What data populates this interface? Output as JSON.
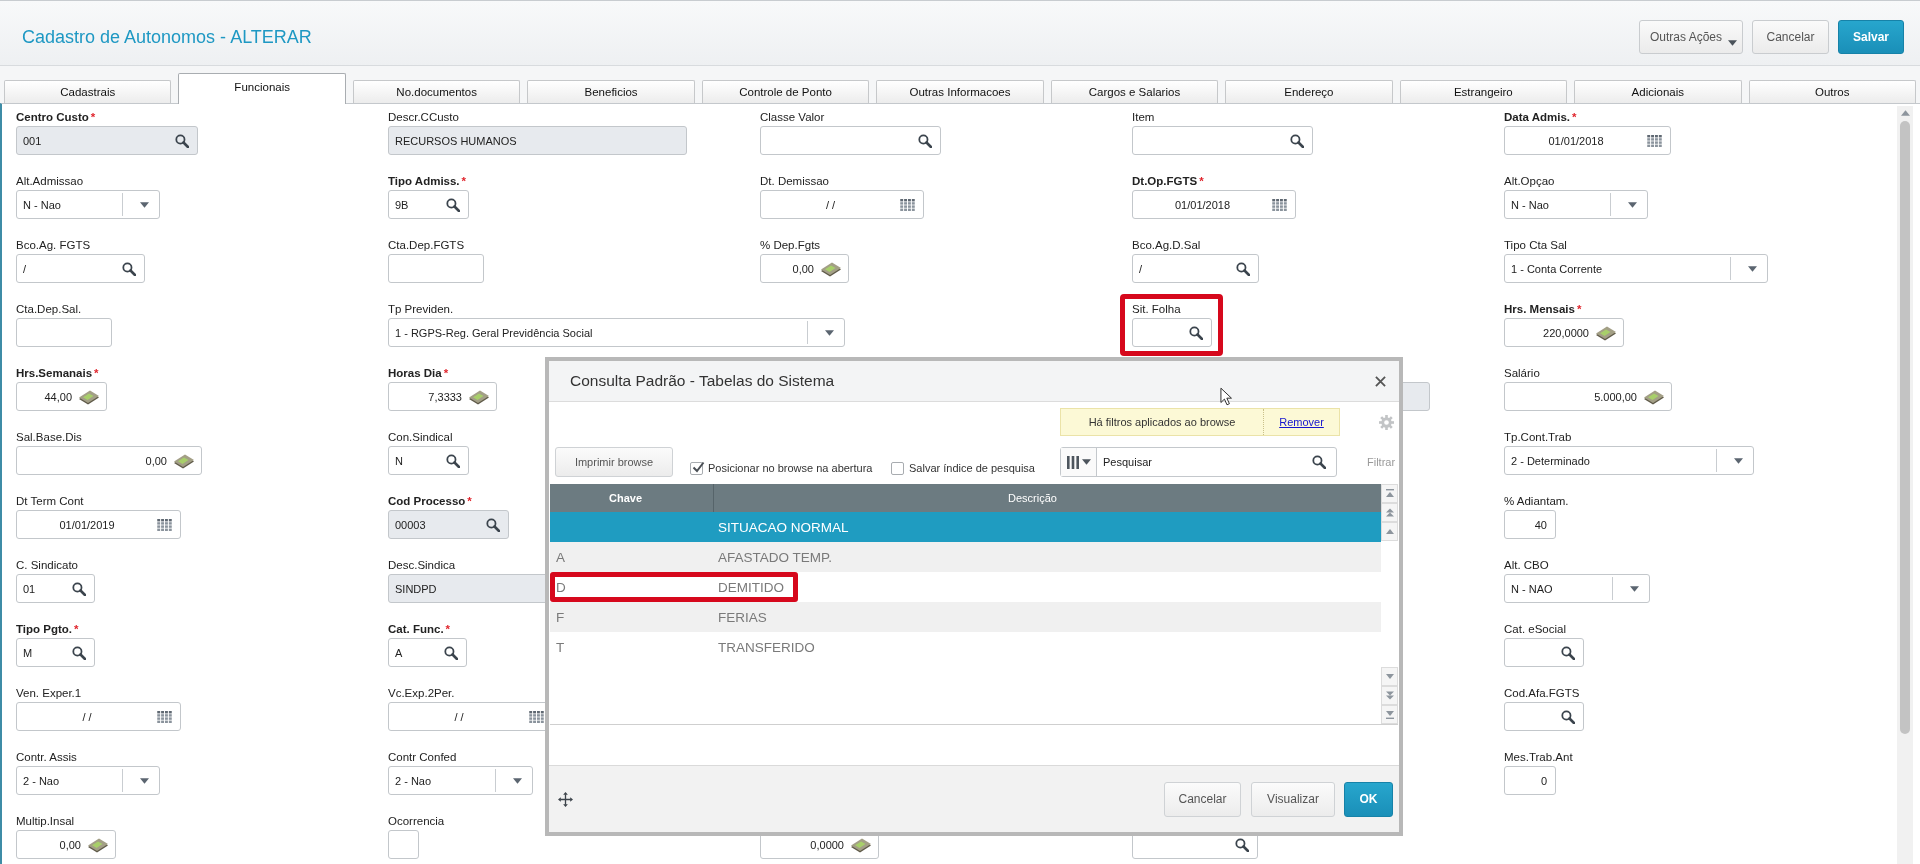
{
  "header": {
    "title": "Cadastro de Autonomos - ALTERAR",
    "actions": [
      {
        "label": "Outras Ações",
        "kind": "menu"
      },
      {
        "label": "Cancelar",
        "kind": "cancel"
      },
      {
        "label": "Salvar",
        "kind": "confirm"
      }
    ]
  },
  "tabs": [
    {
      "label": "Cadastrais",
      "selected": false
    },
    {
      "label": "Funcionais",
      "selected": true
    },
    {
      "label": "No.documentos",
      "selected": false
    },
    {
      "label": "Beneficios",
      "selected": false
    },
    {
      "label": "Controle de Ponto",
      "selected": false
    },
    {
      "label": "Outras Informacoes",
      "selected": false
    },
    {
      "label": "Cargos e Salarios",
      "selected": false
    },
    {
      "label": "Endereço",
      "selected": false
    },
    {
      "label": "Estrangeiro",
      "selected": false
    },
    {
      "label": "Adicionais",
      "selected": false
    },
    {
      "label": "Outros",
      "selected": false
    }
  ],
  "form": {
    "rows": [
      {
        "fields": [
          {
            "label": "Centro Custo",
            "required_mark": "*",
            "kind": "lookup",
            "value": "001",
            "readonly": true,
            "highlighted": false
          },
          {
            "label": "Descr.CCusto",
            "kind": "text",
            "value": "RECURSOS HUMANOS",
            "readonly": true,
            "highlighted": false
          },
          {
            "label": "Classe Valor",
            "kind": "lookup",
            "readonly": false,
            "highlighted": false
          },
          {
            "label": "Item",
            "kind": "lookup",
            "readonly": false,
            "highlighted": false
          },
          {
            "label": "Data Admis.",
            "required_mark": "*",
            "kind": "date",
            "value": "01/01/2018",
            "readonly": false,
            "highlighted": false
          }
        ]
      },
      {
        "fields": [
          {
            "label": "Alt.Admissao",
            "kind": "select",
            "value": "N - Nao",
            "readonly": false,
            "highlighted": false
          },
          {
            "label": "Tipo Admiss.",
            "required_mark": "*",
            "kind": "lookup",
            "value": "9B",
            "readonly": false,
            "highlighted": false
          },
          {
            "label": "Dt. Demissao",
            "kind": "date",
            "value": "/ /",
            "readonly": false,
            "highlighted": false
          },
          {
            "label": "Dt.Op.FGTS",
            "required_mark": "*",
            "kind": "date",
            "value": "01/01/2018",
            "readonly": false,
            "highlighted": false
          },
          {
            "label": "Alt.Opçao",
            "kind": "select",
            "value": "N - Nao",
            "readonly": false,
            "highlighted": false
          }
        ]
      },
      {
        "fields": [
          {
            "label": "Bco.Ag. FGTS",
            "kind": "lookup",
            "value": "/",
            "readonly": false,
            "highlighted": false
          },
          {
            "label": "Cta.Dep.FGTS",
            "kind": "text",
            "readonly": false,
            "highlighted": false
          },
          {
            "label": "% Dep.Fgts",
            "kind": "money",
            "value": "0,00",
            "readonly": false,
            "highlighted": false
          },
          {
            "label": "Bco.Ag.D.Sal",
            "kind": "lookup",
            "value": "/",
            "readonly": false,
            "highlighted": false
          },
          {
            "label": "Tipo Cta Sal",
            "kind": "select",
            "value": "1 - Conta Corrente",
            "readonly": false,
            "highlighted": false
          }
        ]
      },
      {
        "fields": [
          {
            "label": "Cta.Dep.Sal.",
            "kind": "text",
            "readonly": false,
            "highlighted": false
          },
          {
            "label": "Tp Previden.",
            "kind": "select",
            "value": "1 - RGPS-Reg. Geral Previdência Social",
            "readonly": false,
            "highlighted": false
          },
          {
            "label": "Sit. Folha",
            "kind": "lookup",
            "readonly": false,
            "highlighted": true
          },
          {
            "label": "Hrs. Mensais",
            "required_mark": "*",
            "kind": "money",
            "value": "220,0000",
            "readonly": false,
            "highlighted": false
          }
        ]
      },
      {
        "fields": [
          {
            "label": "Hrs.Semanais",
            "required_mark": "*",
            "kind": "money",
            "value": "44,00",
            "readonly": false,
            "highlighted": false
          },
          {
            "label": "Horas Dia",
            "required_mark": "*",
            "kind": "money",
            "value": "7,3333",
            "readonly": false,
            "highlighted": false
          },
          {
            "kind": "text",
            "readonly": true,
            "highlighted": false
          },
          {
            "label": "Salário",
            "kind": "money",
            "value": "5.000,00",
            "readonly": false,
            "highlighted": false
          }
        ]
      },
      {
        "fields": [
          {
            "label": "Sal.Base.Dis",
            "kind": "money",
            "value": "0,00",
            "readonly": false,
            "highlighted": false
          },
          {
            "label": "Con.Sindical",
            "kind": "lookup",
            "value": "N",
            "readonly": false,
            "highlighted": false
          },
          {
            "label": "Tp.Cont.Trab",
            "kind": "select",
            "value": "2 - Determinado",
            "readonly": false,
            "highlighted": false
          }
        ]
      },
      {
        "fields": [
          {
            "label": "Dt Term Cont",
            "kind": "date",
            "value": "01/01/2019",
            "readonly": false,
            "highlighted": false
          },
          {
            "label": "Cod Processo",
            "required_mark": "*",
            "kind": "lookup",
            "value": "00003",
            "readonly": true,
            "highlighted": false
          },
          {
            "label": "% Adiantam.",
            "kind": "number",
            "value": "40",
            "readonly": false,
            "highlighted": false
          }
        ]
      },
      {
        "fields": [
          {
            "label": "C. Sindicato",
            "kind": "lookup",
            "value": "01",
            "readonly": false,
            "highlighted": false
          },
          {
            "label": "Desc.Sindica",
            "kind": "text",
            "value": "SINDPD",
            "readonly": true,
            "highlighted": false
          },
          {
            "label": "Alt. CBO",
            "kind": "select",
            "value": "N - NAO",
            "readonly": false,
            "highlighted": false
          }
        ]
      },
      {
        "fields": [
          {
            "label": "Tipo Pgto.",
            "required_mark": "*",
            "kind": "lookup",
            "value": "M",
            "readonly": false,
            "highlighted": false
          },
          {
            "label": "Cat. Func.",
            "required_mark": "*",
            "kind": "lookup",
            "value": "A",
            "readonly": false,
            "highlighted": false
          },
          {
            "label": "Cat. eSocial",
            "kind": "lookup",
            "readonly": false,
            "highlighted": false
          }
        ]
      },
      {
        "fields": [
          {
            "label": "Ven. Exper.1",
            "kind": "date",
            "value": "/ /",
            "readonly": false,
            "highlighted": false
          },
          {
            "label": "Vc.Exp.2Per.",
            "kind": "date",
            "value": "/ /",
            "readonly": false,
            "highlighted": false
          },
          {
            "label": "Cod.Afa.FGTS",
            "kind": "lookup",
            "readonly": false,
            "highlighted": false
          }
        ]
      },
      {
        "fields": [
          {
            "label": "Contr. Assis",
            "kind": "select",
            "value": "2 - Nao",
            "readonly": false,
            "highlighted": false
          },
          {
            "label": "Contr Confed",
            "kind": "select",
            "value": "2 - Nao",
            "readonly": false,
            "highlighted": false
          },
          {
            "label": "Mes.Trab.Ant",
            "kind": "number",
            "value": "0",
            "readonly": false,
            "highlighted": false
          }
        ]
      },
      {
        "fields": [
          {
            "label": "Multip.Insal",
            "kind": "money",
            "value": "0,00",
            "readonly": false,
            "highlighted": false
          },
          {
            "label": "Ocorrencia",
            "kind": "text",
            "readonly": false,
            "highlighted": false
          },
          {
            "kind": "money",
            "value": "0,0000",
            "readonly": false,
            "highlighted": false
          },
          {
            "kind": "lookup",
            "readonly": false,
            "highlighted": false
          }
        ]
      }
    ]
  },
  "lookup_dialog": {
    "title": "Consulta Padrão - Tabelas do Sistema",
    "filter_notice": {
      "text": "Há filtros aplicados ao browse",
      "link": "Remover"
    },
    "print_button": "Imprimir browse",
    "options": [
      {
        "label": "Posicionar no browse na abertura",
        "checked": true
      },
      {
        "label": "Salvar índice de pesquisa",
        "checked": false
      }
    ],
    "search": {
      "placeholder": "Pesquisar"
    },
    "filter_label": "Filtrar",
    "table": {
      "columns": [
        "Chave",
        "Descrição"
      ],
      "rows": [
        {
          "description": "SITUACAO NORMAL",
          "selected": true,
          "highlighted": false
        },
        {
          "key": "A",
          "description": "AFASTADO TEMP.",
          "selected": false,
          "highlighted": false
        },
        {
          "key": "D",
          "description": "DEMITIDO",
          "selected": false,
          "highlighted": true
        },
        {
          "key": "F",
          "description": "FERIAS",
          "selected": false,
          "highlighted": false
        },
        {
          "key": "T",
          "description": "TRANSFERIDO",
          "selected": false,
          "highlighted": false
        }
      ]
    },
    "buttons": [
      {
        "label": "Cancelar",
        "kind": "cancel"
      },
      {
        "label": "Visualizar",
        "kind": "view"
      },
      {
        "label": "OK",
        "kind": "confirm"
      }
    ]
  }
}
